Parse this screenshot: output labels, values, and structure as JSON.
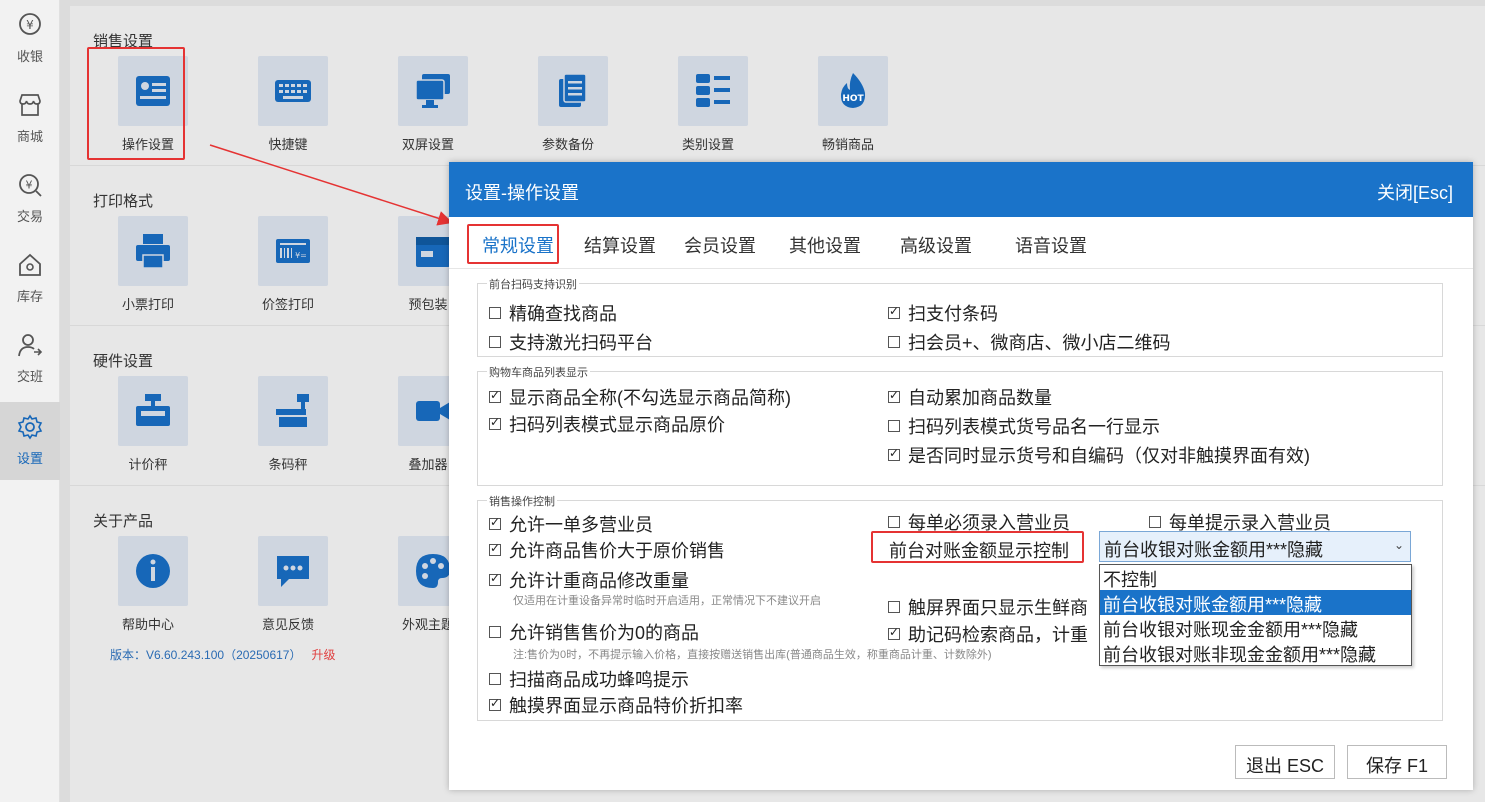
{
  "sidebar": {
    "items": [
      {
        "label": "收银",
        "icon": "cashier-coin-icon"
      },
      {
        "label": "商城",
        "icon": "store-icon"
      },
      {
        "label": "交易",
        "icon": "yuan-search-icon"
      },
      {
        "label": "库存",
        "icon": "house-icon"
      },
      {
        "label": "交班",
        "icon": "user-shift-icon"
      },
      {
        "label": "设置",
        "icon": "gear-icon"
      }
    ]
  },
  "main": {
    "sales": {
      "title": "销售设置",
      "tiles": [
        "操作设置",
        "快捷键",
        "双屏设置",
        "参数备份",
        "类别设置",
        "畅销商品"
      ]
    },
    "print": {
      "title": "打印格式",
      "tiles": [
        "小票打印",
        "价签打印",
        "预包装"
      ]
    },
    "hardware": {
      "title": "硬件设置",
      "tiles": [
        "计价秤",
        "条码秤",
        "叠加器"
      ]
    },
    "about": {
      "title": "关于产品",
      "tiles": [
        "帮助中心",
        "意见反馈",
        "外观主题"
      ],
      "version": "版本：V6.60.243.100（20250617）",
      "upgrade": "升级"
    },
    "hot_badge": "HOT"
  },
  "dialog": {
    "title": "设置-操作设置",
    "close": "关闭[Esc]",
    "tabs": [
      "常规设置",
      "结算设置",
      "会员设置",
      "其他设置",
      "高级设置",
      "语音设置"
    ],
    "group_scan": {
      "legend": "前台扫码支持识别",
      "options": [
        {
          "label": "精确查找商品",
          "checked": false
        },
        {
          "label": "扫支付条码",
          "checked": true
        },
        {
          "label": "支持激光扫码平台",
          "checked": false
        },
        {
          "label": "扫会员+、微商店、微小店二维码",
          "checked": false
        }
      ]
    },
    "group_cart": {
      "legend": "购物车商品列表显示",
      "options": [
        {
          "label": "显示商品全称(不勾选显示商品简称)",
          "checked": true
        },
        {
          "label": "自动累加商品数量",
          "checked": true
        },
        {
          "label": "扫码列表模式显示商品原价",
          "checked": true
        },
        {
          "label": "扫码列表模式货号品名一行显示",
          "checked": false
        },
        {
          "label": "是否同时显示货号和自编码（仅对非触摸界面有效)",
          "checked": true
        }
      ]
    },
    "group_sales": {
      "legend": "销售操作控制",
      "options": [
        {
          "label": "允许一单多营业员",
          "checked": true
        },
        {
          "label": "每单必须录入营业员",
          "checked": false
        },
        {
          "label": "每单提示录入营业员",
          "checked": false
        },
        {
          "label": "允许商品售价大于原价销售",
          "checked": true
        },
        {
          "label": "允许计重商品修改重量",
          "checked": true
        },
        {
          "label": "触屏界面只显示生鲜商",
          "checked": false
        },
        {
          "label": "允许销售售价为0的商品",
          "checked": false
        },
        {
          "label": "助记码检索商品，计重",
          "checked": true
        },
        {
          "label": "扫描商品成功蜂鸣提示",
          "checked": false
        },
        {
          "label": "触摸界面显示商品特价折扣率",
          "checked": true
        }
      ],
      "hint_weight": "仅适用在计重设备异常时临时开启适用，正常情况下不建议开启",
      "hint_zero": "注:售价为0时，不再提示输入价格，直接按赠送销售出库(普通商品生效，称重商品计重、计数除外)",
      "amount_control_label": "前台对账金额显示控制",
      "select_value": "前台收银对账金额用***隐藏",
      "select_options": [
        "不控制",
        "前台收银对账金额用***隐藏",
        "前台收银对账现金金额用***隐藏",
        "前台收银对账非现金金额用***隐藏"
      ],
      "selected_index": 1
    },
    "buttons": {
      "exit": "退出 ESC",
      "save": "保存 F1"
    }
  },
  "colors": {
    "accent": "#1a73c9",
    "highlight": "#e53333"
  }
}
